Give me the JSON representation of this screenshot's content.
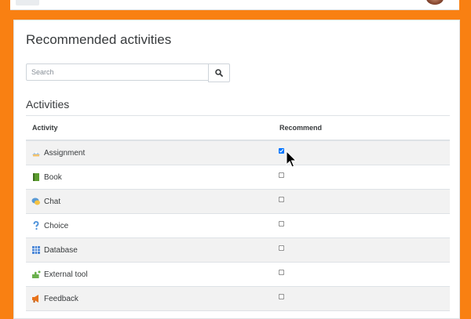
{
  "header": {
    "crumb": "· · · · · · · ·"
  },
  "page": {
    "title": "Recommended activities",
    "search_placeholder": "Search",
    "section_title": "Activities"
  },
  "table": {
    "col_activity": "Activity",
    "col_recommend": "Recommend",
    "rows": [
      {
        "name": "Assignment",
        "icon": "assignment-icon",
        "checked": true
      },
      {
        "name": "Book",
        "icon": "book-icon",
        "checked": false
      },
      {
        "name": "Chat",
        "icon": "chat-icon",
        "checked": false
      },
      {
        "name": "Choice",
        "icon": "choice-icon",
        "checked": false
      },
      {
        "name": "Database",
        "icon": "database-icon",
        "checked": false
      },
      {
        "name": "External tool",
        "icon": "external-tool-icon",
        "checked": false
      },
      {
        "name": "Feedback",
        "icon": "feedback-icon",
        "checked": false
      }
    ]
  },
  "colors": {
    "brand_orange": "#f98012",
    "row_stripe": "#f2f2f2"
  }
}
